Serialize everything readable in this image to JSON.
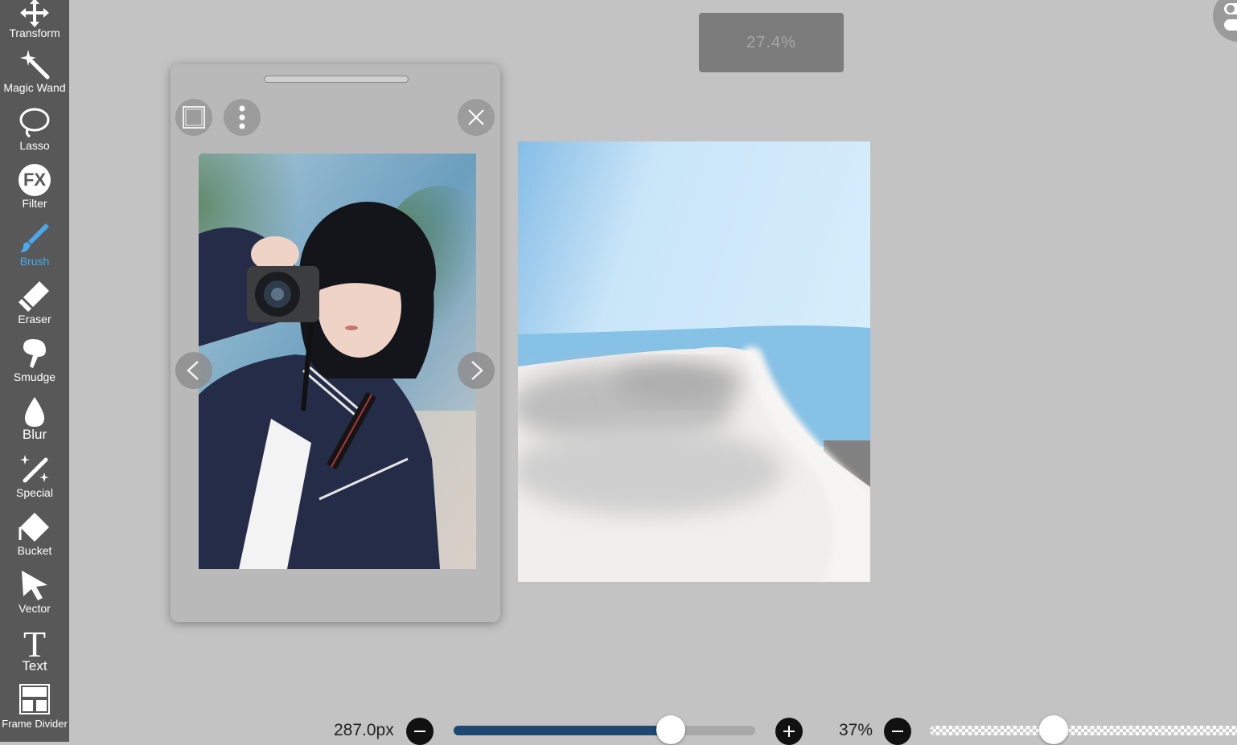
{
  "toolbar": {
    "items": [
      {
        "label": "Transform",
        "icon": "transform-icon"
      },
      {
        "label": "Magic Wand",
        "icon": "magic-wand-icon"
      },
      {
        "label": "Lasso",
        "icon": "lasso-icon"
      },
      {
        "label": "Filter",
        "icon": "fx-icon",
        "icon_text": "FX"
      },
      {
        "label": "Brush",
        "icon": "brush-icon",
        "active": true
      },
      {
        "label": "Eraser",
        "icon": "eraser-icon"
      },
      {
        "label": "Smudge",
        "icon": "smudge-icon"
      },
      {
        "label": "Blur",
        "icon": "drop-icon"
      },
      {
        "label": "Special",
        "icon": "special-icon"
      },
      {
        "label": "Bucket",
        "icon": "bucket-icon"
      },
      {
        "label": "Vector",
        "icon": "cursor-icon"
      },
      {
        "label": "Text",
        "icon": "text-icon",
        "icon_text": "T"
      },
      {
        "label": "Frame Divider",
        "icon": "frame-divider-icon"
      }
    ],
    "active_color": "#4aa8ee",
    "background": "#585858"
  },
  "zoom_badge": {
    "text": "27.4%"
  },
  "reference_panel": {
    "buttons": [
      "frame-icon",
      "more-icon",
      "close-icon",
      "prev-icon",
      "next-icon"
    ]
  },
  "bottom_bar": {
    "brush_size": {
      "text": "287.0px",
      "slider_fraction": 0.72,
      "fill_color": "#1f4773"
    },
    "opacity": {
      "text": "37%",
      "slider_fraction": 0.37
    }
  }
}
